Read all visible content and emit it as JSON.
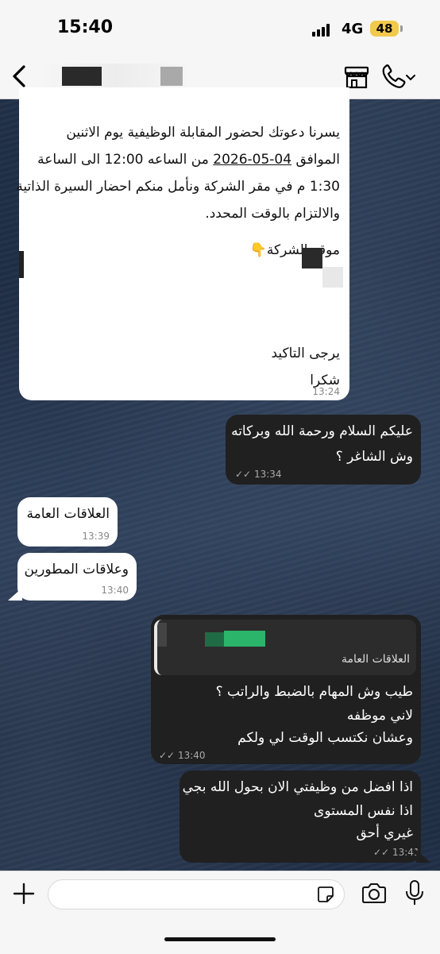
{
  "status_bar": {
    "time": "15:40",
    "network": "4G",
    "battery": "48"
  },
  "messages": {
    "m1": {
      "lines": [
        "يسرنا دعوتك لحضور المقابلة الوظيفية يوم الاثنين",
        "الموافق 04-05-2026 من الساعه 12:00    الى الساعة",
        "1:30 م في مقر الشركة ونأمل منكم احضار السيرة الذاتية",
        "والالتزام بالوقت المحدد."
      ],
      "location_label": "موقع الشركة👇",
      "confirm": "يرجى التاكيد",
      "thanks": "شكرا",
      "time": "13:24"
    },
    "m2": {
      "lines": [
        "عليكم السلام ورحمة الله وبركاته",
        "وش الشاغر ؟"
      ],
      "time": "13:34"
    },
    "m3": {
      "text": "العلاقات العامة",
      "time": "13:39"
    },
    "m4": {
      "text": "وعلاقات المطورين",
      "time": "13:40"
    },
    "m5": {
      "quote": "العلاقات العامة",
      "lines": [
        "طيب وش المهام بالضبط والراتب ؟",
        "لاني موظفه",
        "وعشان نكتسب الوقت لي ولكم"
      ],
      "time": "13:40"
    },
    "m6": {
      "lines": [
        "اذا افضل من وظيفتي الان بحول الله بجي",
        "اذا نفس المستوى",
        "غيري أحق"
      ],
      "time": "13:41"
    }
  },
  "input": {
    "placeholder": ""
  }
}
